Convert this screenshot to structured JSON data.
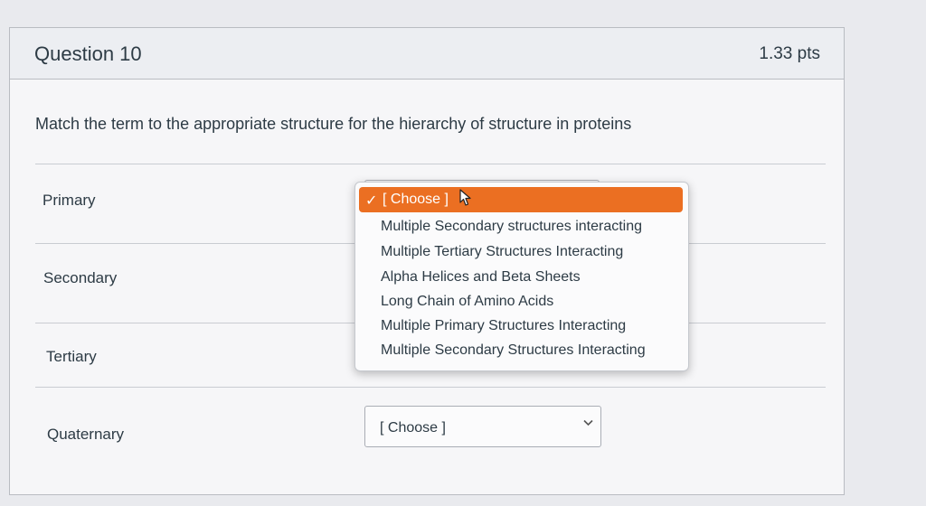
{
  "question": {
    "title": "Question 10",
    "points": "1.33 pts",
    "prompt": "Match the term to the appropriate structure for the hierarchy of structure in proteins"
  },
  "rows": [
    {
      "term": "Primary",
      "selected": "[ Choose ]"
    },
    {
      "term": "Secondary",
      "selected": "[ Choose ]"
    },
    {
      "term": "Tertiary",
      "selected": "[ Choose ]"
    },
    {
      "term": "Quaternary",
      "selected": "[ Choose ]"
    }
  ],
  "dropdown": {
    "check_glyph": "✓",
    "selected_label": "[ Choose ]",
    "options": [
      "Multiple Secondary structures interacting",
      "Multiple Tertiary Structures Interacting",
      "Alpha Helices and Beta Sheets",
      "Long Chain of Amino Acids",
      "Multiple Primary Structures Interacting",
      "Multiple Secondary Structures Interacting"
    ],
    "highlight_color": "#eb6f22"
  },
  "icons": {
    "chevron": "chevron-down-icon",
    "cursor": "mouse-pointer-icon"
  }
}
